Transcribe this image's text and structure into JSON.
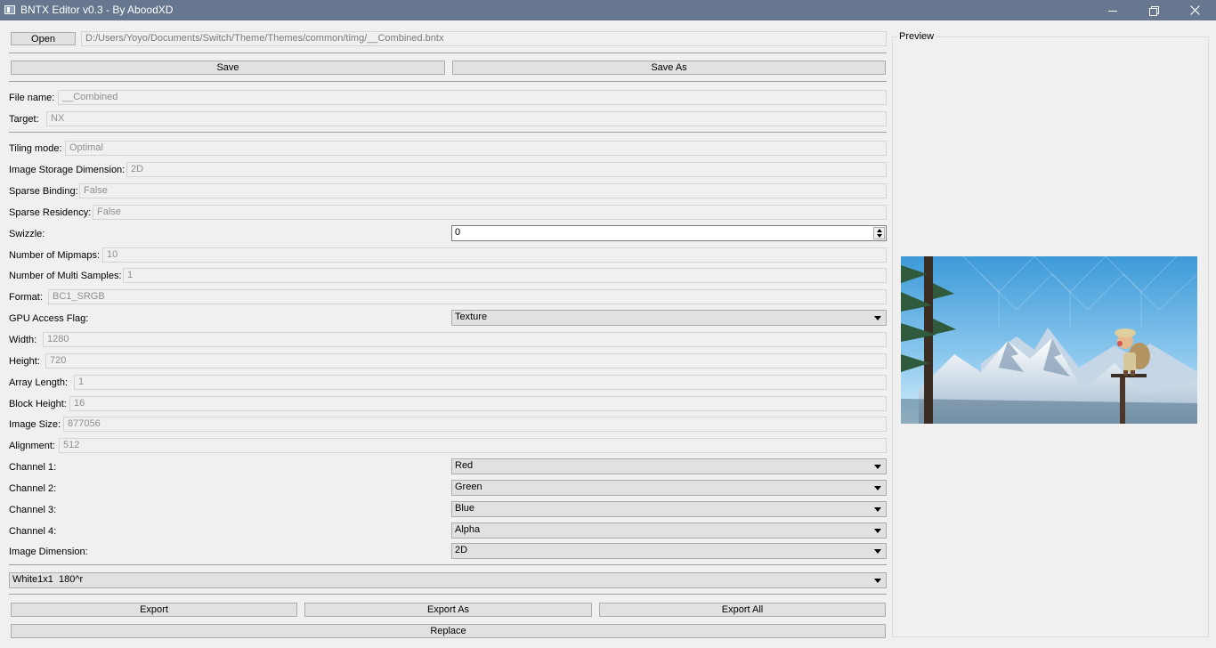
{
  "window": {
    "title": "BNTX Editor v0.3 - By AboodXD"
  },
  "toolbar": {
    "open_label": "Open",
    "file_path": "D:/Users/Yoyo/Documents/Switch/Theme/Themes/common/timg/__Combined.bntx",
    "save_label": "Save",
    "save_as_label": "Save As"
  },
  "fields": {
    "file_name": {
      "label": "File name:",
      "value": "__Combined"
    },
    "target": {
      "label": "Target:",
      "value": "NX"
    },
    "tiling_mode": {
      "label": "Tiling mode:",
      "value": "Optimal"
    },
    "image_storage_dimension": {
      "label": "Image Storage Dimension:",
      "value": "2D"
    },
    "sparse_binding": {
      "label": "Sparse Binding:",
      "value": "False"
    },
    "sparse_residency": {
      "label": "Sparse Residency:",
      "value": "False"
    },
    "swizzle": {
      "label": "Swizzle:",
      "value": "0"
    },
    "mipmaps": {
      "label": "Number of Mipmaps:",
      "value": "10"
    },
    "multi_samples": {
      "label": "Number of Multi Samples:",
      "value": "1"
    },
    "format": {
      "label": "Format:",
      "value": "BC1_SRGB"
    },
    "gpu_access_flag": {
      "label": "GPU Access Flag:",
      "value": "Texture"
    },
    "width": {
      "label": "Width:",
      "value": "1280"
    },
    "height": {
      "label": "Height:",
      "value": "720"
    },
    "array_length": {
      "label": "Array Length:",
      "value": "1"
    },
    "block_height": {
      "label": "Block Height:",
      "value": "16"
    },
    "image_size": {
      "label": "Image Size:",
      "value": "877056"
    },
    "alignment": {
      "label": "Alignment:",
      "value": "512"
    },
    "channel_1": {
      "label": "Channel 1:",
      "value": "Red"
    },
    "channel_2": {
      "label": "Channel 2:",
      "value": "Green"
    },
    "channel_3": {
      "label": "Channel 3:",
      "value": "Blue"
    },
    "channel_4": {
      "label": "Channel 4:",
      "value": "Alpha"
    },
    "image_dimension": {
      "label": "Image Dimension:",
      "value": "2D"
    }
  },
  "texture_select": {
    "value": "White1x1  180^r"
  },
  "bottom": {
    "export_label": "Export",
    "export_as_label": "Export As",
    "export_all_label": "Export All",
    "replace_label": "Replace"
  },
  "preview": {
    "title": "Preview"
  },
  "colors": {
    "titlebar": "#66778f",
    "window_bg": "#f0f0f0",
    "button_bg": "#e1e1e1"
  },
  "icons": [
    "app-icon",
    "minimize-icon",
    "maximize-icon",
    "close-icon",
    "chevron-down-icon",
    "spin-up-icon",
    "spin-down-icon"
  ]
}
